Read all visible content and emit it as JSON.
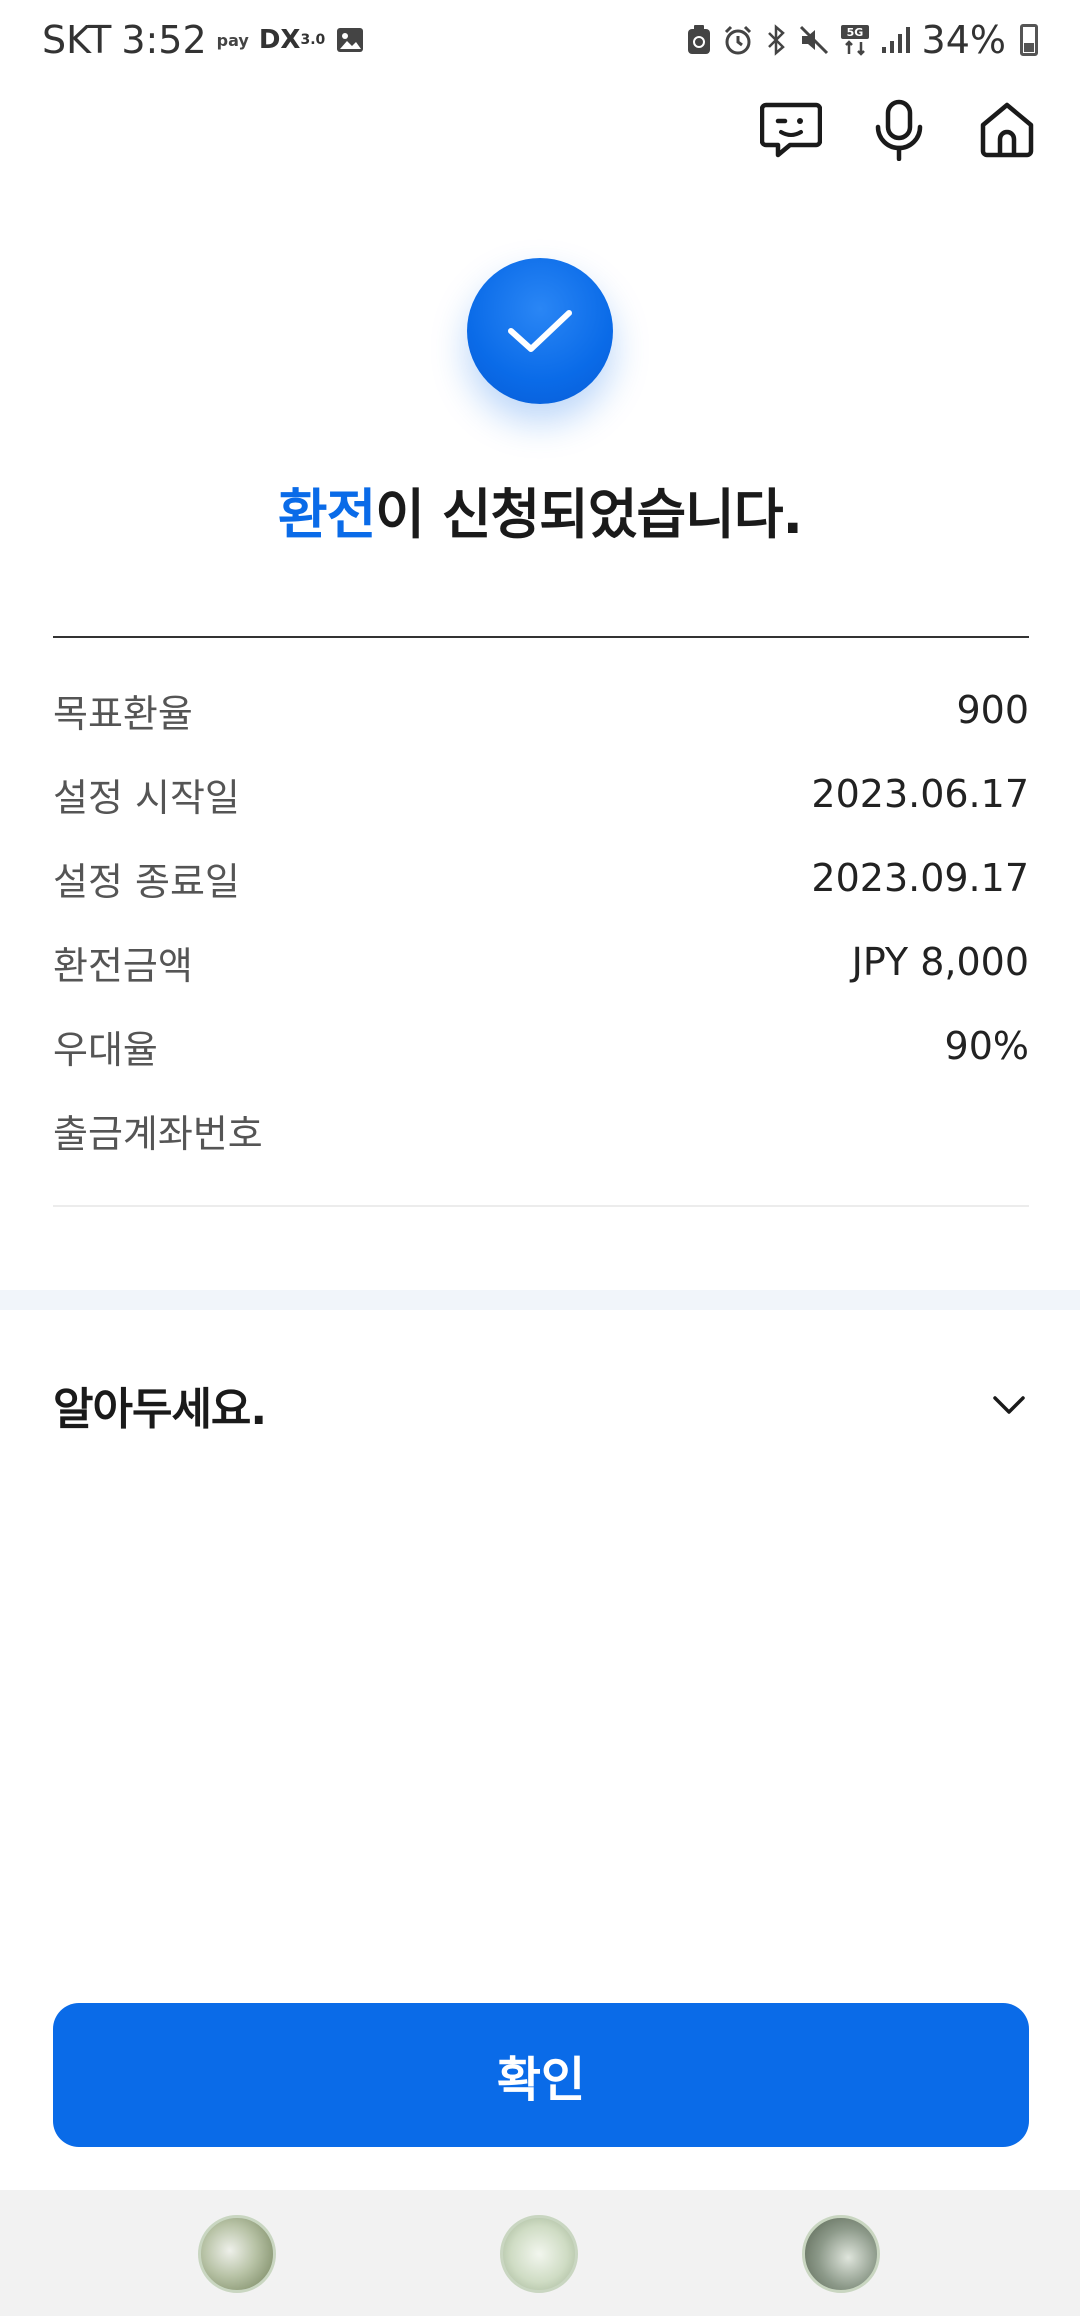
{
  "status_bar": {
    "carrier": "SKT",
    "time": "3:52",
    "pay_label": "pay",
    "dx_label": "DX",
    "dx_version": "3.0",
    "network": "5G",
    "battery": "34%"
  },
  "top_actions": {
    "icons": [
      "chat-bot-icon",
      "microphone-icon",
      "home-icon"
    ]
  },
  "headline": {
    "accent": "환전",
    "rest": "이 신청되었습니다."
  },
  "details": [
    {
      "label": "목표환율",
      "value": "900"
    },
    {
      "label": "설정 시작일",
      "value": "2023.06.17"
    },
    {
      "label": "설정 종료일",
      "value": "2023.09.17"
    },
    {
      "label": "환전금액",
      "value": "JPY 8,000"
    },
    {
      "label": "우대율",
      "value": "90%"
    },
    {
      "label": "출금계좌번호",
      "value": ""
    }
  ],
  "notice": {
    "title": "알아두세요."
  },
  "confirm_button": {
    "label": "확인"
  },
  "colors": {
    "accent": "#0a6be8",
    "text": "#1a1a1a",
    "label": "#555555"
  }
}
